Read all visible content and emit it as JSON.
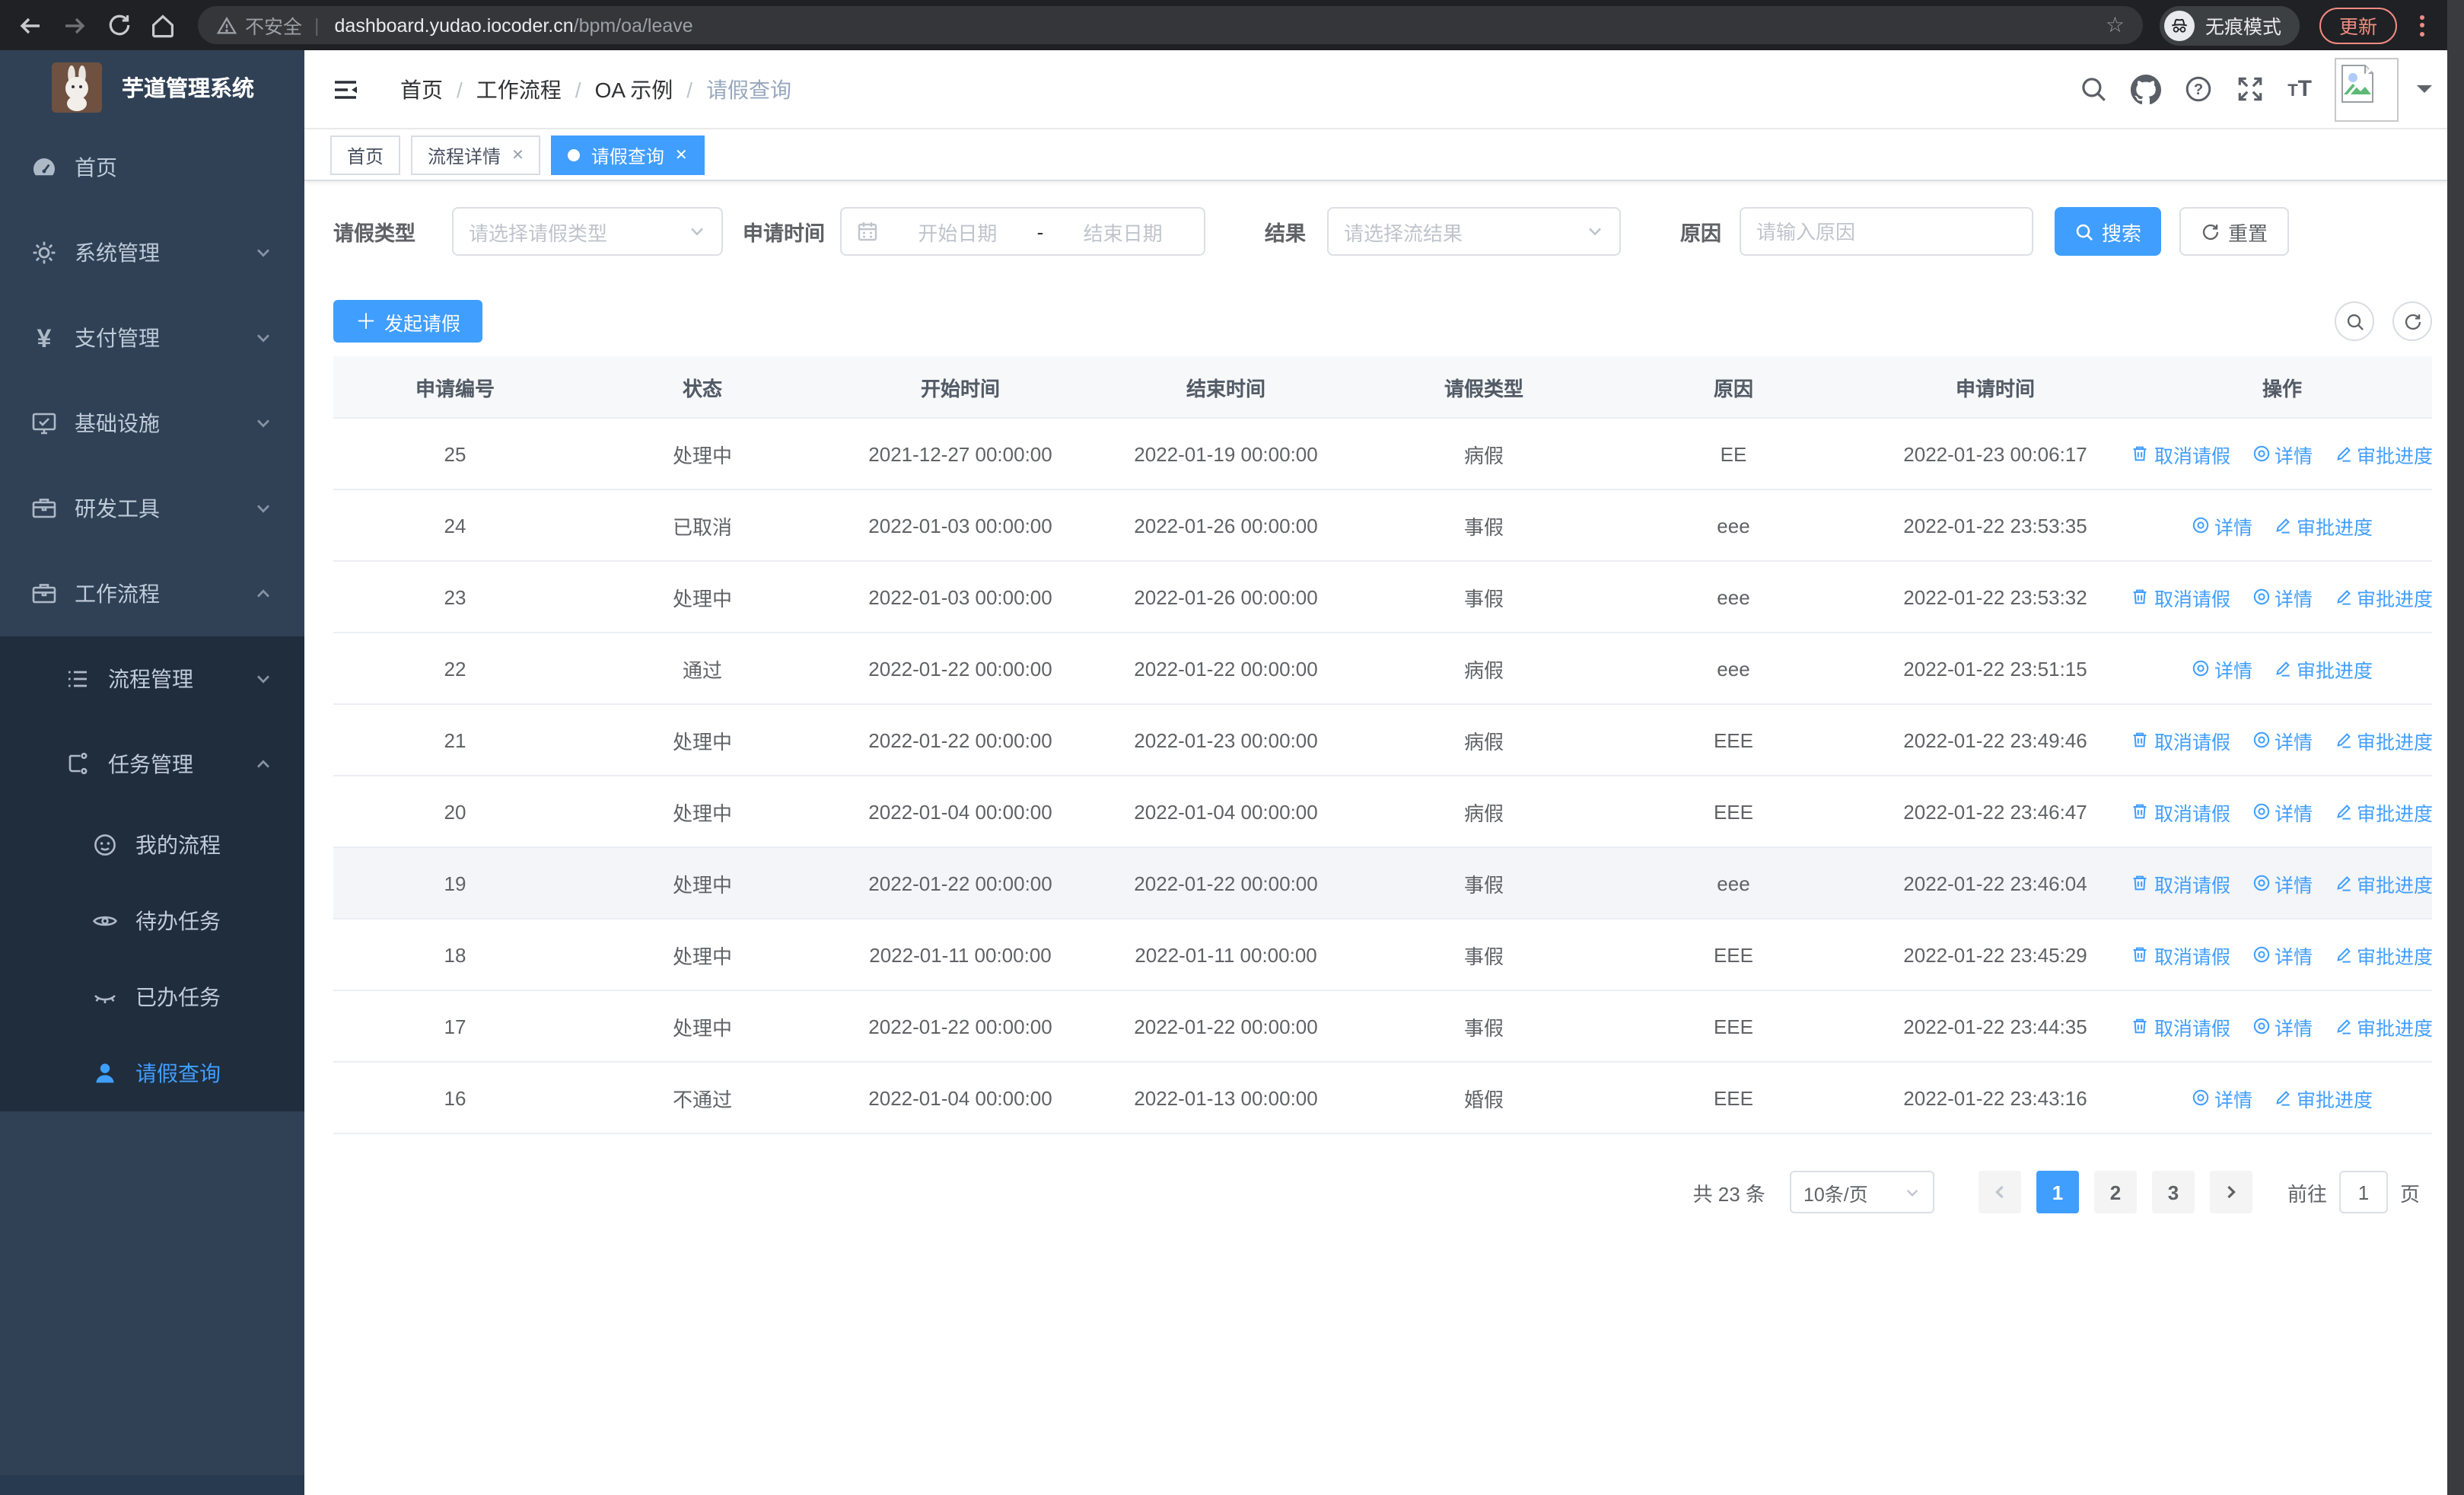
{
  "colors": {
    "primary": "#409eff",
    "sidebar_bg": "#304156",
    "submenu_bg": "#1f2d3d",
    "accent_salmon": "#f28b82"
  },
  "browser": {
    "security_label": "不安全",
    "url_host": "dashboard.yudao.iocoder.cn",
    "url_path": "/bpm/oa/leave",
    "incognito_label": "无痕模式",
    "update_label": "更新"
  },
  "sidebar": {
    "logo_title": "芋道管理系统",
    "home": "首页",
    "system": "系统管理",
    "payment": "支付管理",
    "infra": "基础设施",
    "devtools": "研发工具",
    "workflow": "工作流程",
    "process_mgmt": "流程管理",
    "task_mgmt": "任务管理",
    "my_process": "我的流程",
    "todo_tasks": "待办任务",
    "done_tasks": "已办任务",
    "leave_query": "请假查询"
  },
  "header": {
    "breadcrumb": [
      "首页",
      "工作流程",
      "OA 示例",
      "请假查询"
    ],
    "tabs": [
      {
        "label": "首页"
      },
      {
        "label": "流程详情"
      },
      {
        "label": "请假查询"
      }
    ]
  },
  "filters": {
    "leave_type_label": "请假类型",
    "leave_type_placeholder": "请选择请假类型",
    "apply_time_label": "申请时间",
    "date_start_placeholder": "开始日期",
    "date_separator": "-",
    "date_end_placeholder": "结束日期",
    "result_label": "结果",
    "result_placeholder": "请选择流结果",
    "reason_label": "原因",
    "reason_placeholder": "请输入原因",
    "search_label": "搜索",
    "reset_label": "重置"
  },
  "toolbar": {
    "create_label": "发起请假"
  },
  "table": {
    "headers": [
      "申请编号",
      "状态",
      "开始时间",
      "结束时间",
      "请假类型",
      "原因",
      "申请时间",
      "操作"
    ],
    "action_labels": {
      "cancel": "取消请假",
      "detail": "详情",
      "progress": "审批进度"
    },
    "rows": [
      {
        "id": "25",
        "status": "处理中",
        "start": "2021-12-27 00:00:00",
        "end": "2022-01-19 00:00:00",
        "type": "病假",
        "reason": "EE",
        "applied": "2022-01-23 00:06:17",
        "actions": [
          "cancel",
          "detail",
          "progress"
        ],
        "highlighted": false
      },
      {
        "id": "24",
        "status": "已取消",
        "start": "2022-01-03 00:00:00",
        "end": "2022-01-26 00:00:00",
        "type": "事假",
        "reason": "eee",
        "applied": "2022-01-22 23:53:35",
        "actions": [
          "detail",
          "progress"
        ],
        "highlighted": false
      },
      {
        "id": "23",
        "status": "处理中",
        "start": "2022-01-03 00:00:00",
        "end": "2022-01-26 00:00:00",
        "type": "事假",
        "reason": "eee",
        "applied": "2022-01-22 23:53:32",
        "actions": [
          "cancel",
          "detail",
          "progress"
        ],
        "highlighted": false
      },
      {
        "id": "22",
        "status": "通过",
        "start": "2022-01-22 00:00:00",
        "end": "2022-01-22 00:00:00",
        "type": "病假",
        "reason": "eee",
        "applied": "2022-01-22 23:51:15",
        "actions": [
          "detail",
          "progress"
        ],
        "highlighted": false
      },
      {
        "id": "21",
        "status": "处理中",
        "start": "2022-01-22 00:00:00",
        "end": "2022-01-23 00:00:00",
        "type": "病假",
        "reason": "EEE",
        "applied": "2022-01-22 23:49:46",
        "actions": [
          "cancel",
          "detail",
          "progress"
        ],
        "highlighted": false
      },
      {
        "id": "20",
        "status": "处理中",
        "start": "2022-01-04 00:00:00",
        "end": "2022-01-04 00:00:00",
        "type": "病假",
        "reason": "EEE",
        "applied": "2022-01-22 23:46:47",
        "actions": [
          "cancel",
          "detail",
          "progress"
        ],
        "highlighted": false
      },
      {
        "id": "19",
        "status": "处理中",
        "start": "2022-01-22 00:00:00",
        "end": "2022-01-22 00:00:00",
        "type": "事假",
        "reason": "eee",
        "applied": "2022-01-22 23:46:04",
        "actions": [
          "cancel",
          "detail",
          "progress"
        ],
        "highlighted": true
      },
      {
        "id": "18",
        "status": "处理中",
        "start": "2022-01-11 00:00:00",
        "end": "2022-01-11 00:00:00",
        "type": "事假",
        "reason": "EEE",
        "applied": "2022-01-22 23:45:29",
        "actions": [
          "cancel",
          "detail",
          "progress"
        ],
        "highlighted": false
      },
      {
        "id": "17",
        "status": "处理中",
        "start": "2022-01-22 00:00:00",
        "end": "2022-01-22 00:00:00",
        "type": "事假",
        "reason": "EEE",
        "applied": "2022-01-22 23:44:35",
        "actions": [
          "cancel",
          "detail",
          "progress"
        ],
        "highlighted": false
      },
      {
        "id": "16",
        "status": "不通过",
        "start": "2022-01-04 00:00:00",
        "end": "2022-01-13 00:00:00",
        "type": "婚假",
        "reason": "EEE",
        "applied": "2022-01-22 23:43:16",
        "actions": [
          "detail",
          "progress"
        ],
        "highlighted": false
      }
    ]
  },
  "pagination": {
    "total_label": "共 23 条",
    "page_size_label": "10条/页",
    "pages": [
      "1",
      "2",
      "3"
    ],
    "active_page": "1",
    "goto_label": "前往",
    "goto_value": "1",
    "page_suffix": "页"
  }
}
